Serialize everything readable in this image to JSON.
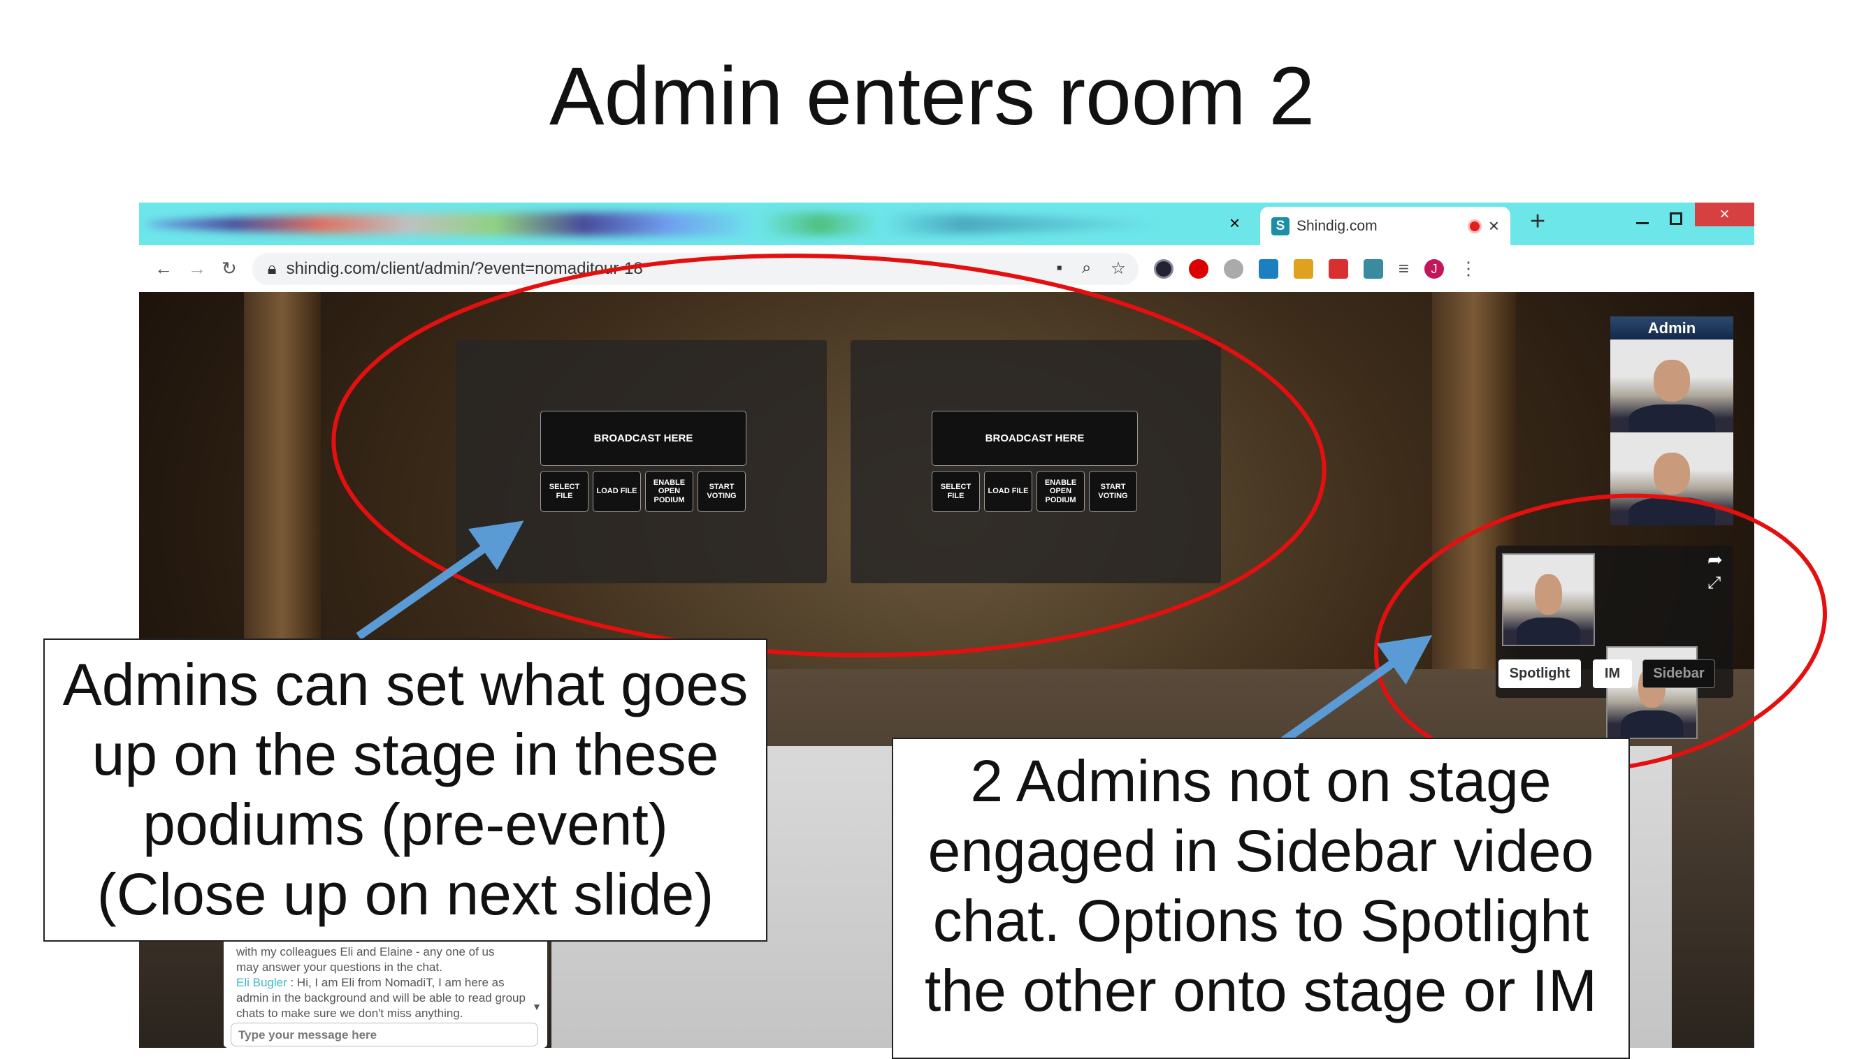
{
  "slide": {
    "title": "Admin enters room 2"
  },
  "browser": {
    "tab_title": "Shindig.com",
    "tab_icon": "S",
    "url": "shindig.com/client/admin/?event=nomaditour-18",
    "profile_initial": "J",
    "close_glyph": "×",
    "new_tab_glyph": "+"
  },
  "podiums": [
    {
      "broadcast": "BROADCAST HERE",
      "buttons": [
        "SELECT FILE",
        "LOAD FILE",
        "ENABLE OPEN PODIUM",
        "START VOTING"
      ]
    },
    {
      "broadcast": "BROADCAST HERE",
      "buttons": [
        "SELECT FILE",
        "LOAD FILE",
        "ENABLE OPEN PODIUM",
        "START VOTING"
      ]
    }
  ],
  "admin_panel": {
    "header": "Admin"
  },
  "sidebar_chat": {
    "buttons": {
      "spotlight": "Spotlight",
      "im": "IM",
      "sidebar": "Sidebar"
    }
  },
  "chat": {
    "partial_line": "with my colleagues Eli and Elaine - any one of us",
    "line2": "may answer your questions in the chat.",
    "author": "Eli Bugler",
    "message": " : Hi, I am Eli from NomadiT, I am here as admin in the background and will be able to read group chats to make sure we don't miss anything.",
    "placeholder": "Type your message here"
  },
  "callouts": {
    "left": [
      "Admins can set what goes",
      "up on the stage in these",
      "podiums (pre-event)",
      "(Close up on next slide)"
    ],
    "right": [
      "2 Admins not on stage",
      "engaged in Sidebar video",
      "chat. Options to Spotlight",
      "the other onto stage or IM"
    ]
  },
  "colors": {
    "annotation_ellipse": "#e41010",
    "annotation_arrow": "#5b9bd5",
    "tabbar": "#6de6ea",
    "close_button": "#d64040"
  }
}
